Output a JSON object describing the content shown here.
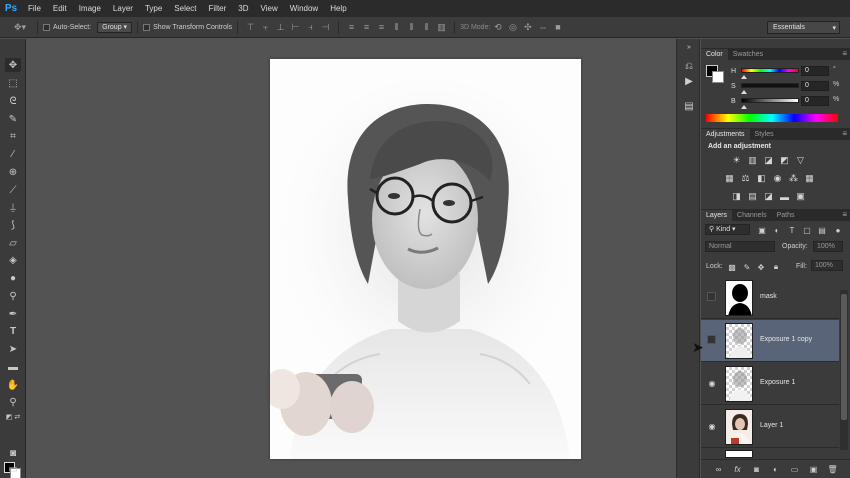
{
  "app": {
    "logo": "Ps"
  },
  "menu": [
    "File",
    "Edit",
    "Image",
    "Layer",
    "Type",
    "Select",
    "Filter",
    "3D",
    "View",
    "Window",
    "Help"
  ],
  "options_bar": {
    "auto_select_label": "Auto-Select:",
    "auto_select_value": "Group",
    "show_transform_label": "Show Transform Controls",
    "mode_3d_label": "3D Mode:",
    "workspace": "Essentials"
  },
  "color_panel": {
    "tabs": [
      "Color",
      "Swatches"
    ],
    "fg_color": "#000000",
    "bg_color": "#ffffff",
    "h_label": "H",
    "h_value": "0",
    "h_unit": "°",
    "s_label": "S",
    "s_value": "0",
    "s_unit": "%",
    "b_label": "B",
    "b_value": "0",
    "b_unit": "%"
  },
  "adjustments_panel": {
    "tabs": [
      "Adjustments",
      "Styles"
    ],
    "heading": "Add an adjustment",
    "icons_row1": [
      "brightness-contrast-icon",
      "levels-icon",
      "curves-icon",
      "exposure-icon",
      "vibrance-icon"
    ],
    "icons_row2": [
      "hue-saturation-icon",
      "color-balance-icon",
      "black-white-icon",
      "photo-filter-icon",
      "channel-mixer-icon",
      "color-lookup-icon"
    ],
    "icons_row3": [
      "invert-icon",
      "posterize-icon",
      "threshold-icon",
      "gradient-map-icon",
      "selective-color-icon"
    ]
  },
  "layers_panel": {
    "tabs": [
      "Layers",
      "Channels",
      "Paths"
    ],
    "filter_kind": "Kind",
    "blend_mode": "Normal",
    "opacity_label": "Opacity:",
    "opacity_value": "100%",
    "lock_label": "Lock:",
    "fill_label": "Fill:",
    "fill_value": "100%",
    "layers": [
      {
        "name": "mask",
        "visible": false,
        "selected": false
      },
      {
        "name": "Exposure 1 copy",
        "visible": false,
        "selected": true
      },
      {
        "name": "Exposure 1",
        "visible": true,
        "selected": false
      },
      {
        "name": "Layer 1",
        "visible": true,
        "selected": false
      }
    ]
  },
  "colors": {
    "ui_dark": "#2b2b2b",
    "panel": "#3b3b3b",
    "workspace_bg": "#535353",
    "selected_layer": "#5a6478",
    "ps_blue": "#31a8ff"
  }
}
